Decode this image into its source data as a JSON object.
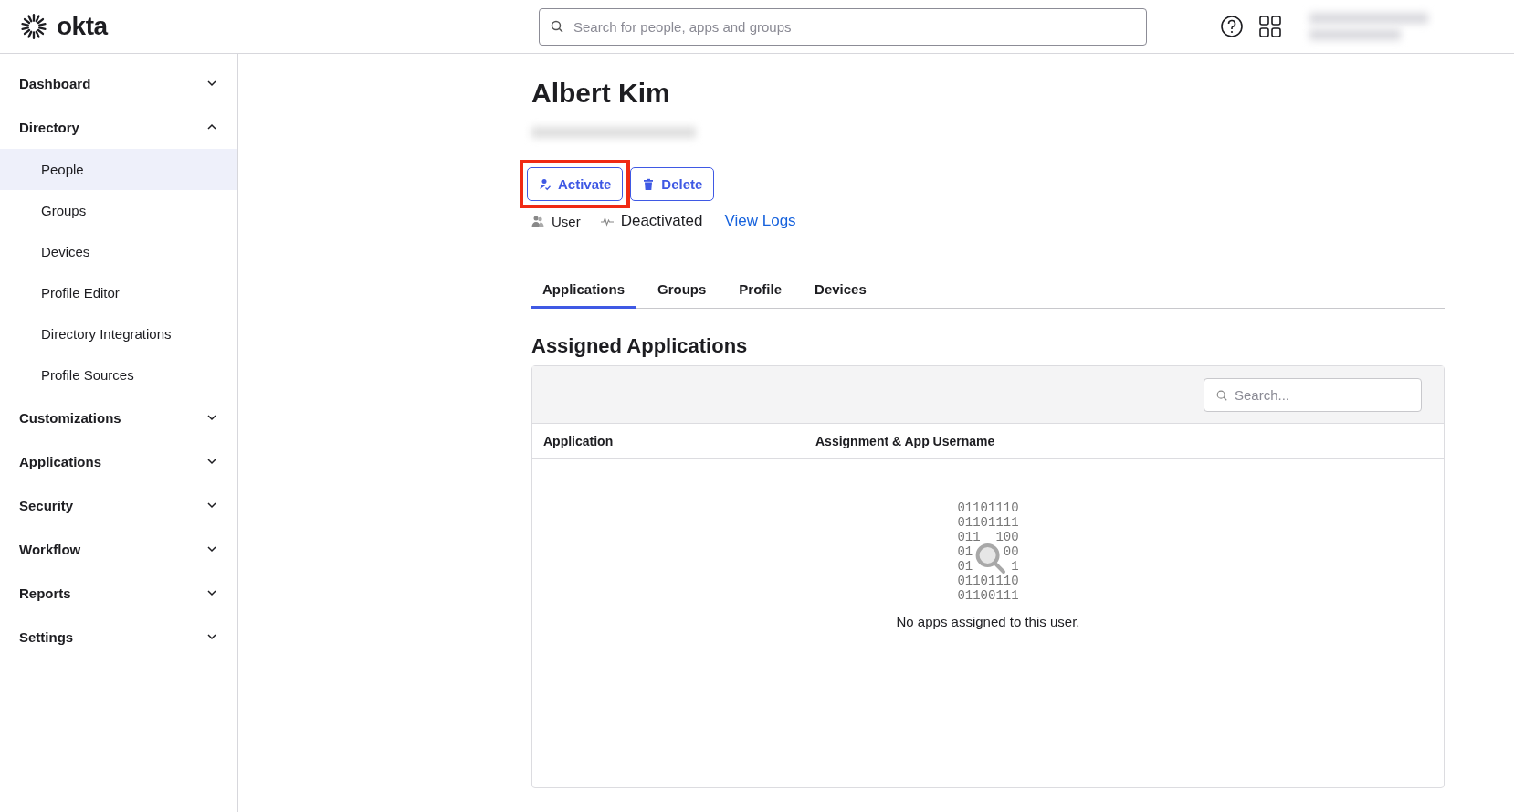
{
  "topbar": {
    "logo": "okta",
    "search": {
      "placeholder": "Search for people, apps and groups"
    }
  },
  "sidebar": {
    "items": [
      {
        "label": "Dashboard",
        "expanded": false
      },
      {
        "label": "Directory",
        "expanded": true,
        "children": [
          {
            "label": "People",
            "selected": true
          },
          {
            "label": "Groups",
            "selected": false
          },
          {
            "label": "Devices",
            "selected": false
          },
          {
            "label": "Profile Editor",
            "selected": false
          },
          {
            "label": "Directory Integrations",
            "selected": false
          },
          {
            "label": "Profile Sources",
            "selected": false
          }
        ]
      },
      {
        "label": "Customizations",
        "expanded": false
      },
      {
        "label": "Applications",
        "expanded": false
      },
      {
        "label": "Security",
        "expanded": false
      },
      {
        "label": "Workflow",
        "expanded": false
      },
      {
        "label": "Reports",
        "expanded": false
      },
      {
        "label": "Settings",
        "expanded": false
      }
    ]
  },
  "profile": {
    "name": "Albert Kim",
    "actions": [
      {
        "label": "Activate",
        "kind": "activate",
        "highlighted": true
      },
      {
        "label": "Delete",
        "kind": "delete",
        "highlighted": false
      }
    ],
    "meta": [
      {
        "label": "User",
        "kind": "user"
      },
      {
        "label": "Deactivated",
        "kind": "status"
      }
    ],
    "link": "View Logs"
  },
  "tabs": [
    {
      "label": "Applications",
      "selected": true
    },
    {
      "label": "Groups",
      "selected": false
    },
    {
      "label": "Profile",
      "selected": false
    },
    {
      "label": "Devices",
      "selected": false
    }
  ],
  "section": {
    "title": "Assigned Applications",
    "search": {
      "placeholder": "Search..."
    },
    "columns": [
      "Application",
      "Assignment & App Username"
    ],
    "empty": {
      "binary": [
        [
          "01101110"
        ],
        [
          "01101111"
        ],
        [
          "011",
          "100"
        ],
        [
          "01",
          "00"
        ],
        [
          "01",
          "1"
        ],
        [
          "01101110"
        ],
        [
          "01100111"
        ]
      ],
      "message": "No apps assigned to this user."
    }
  }
}
